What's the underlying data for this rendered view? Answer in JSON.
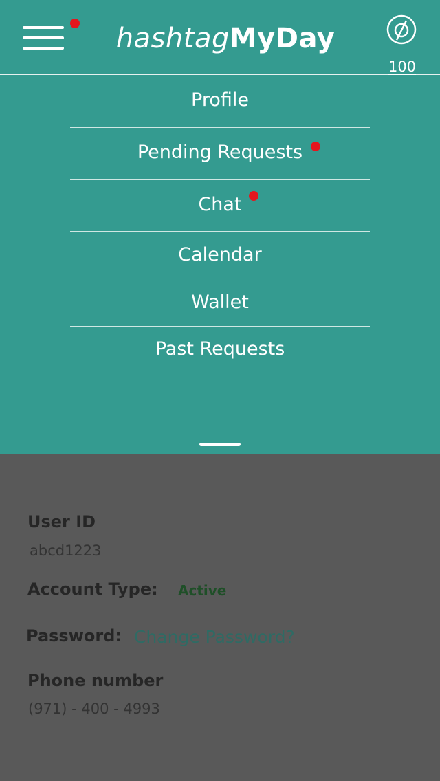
{
  "header": {
    "logo_light": "hashtag",
    "logo_bold": "MyDay",
    "coin_amount": "100",
    "menu_icon": "hamburger-menu-icon",
    "coin_icon": "coin-icon",
    "notification_color": "#e4161e"
  },
  "menu": {
    "items": [
      {
        "label": "Profile",
        "notification": false
      },
      {
        "label": "Pending Requests",
        "notification": true
      },
      {
        "label": "Chat",
        "notification": true
      },
      {
        "label": "Calendar",
        "notification": false
      },
      {
        "label": "Wallet",
        "notification": false
      },
      {
        "label": "Past Requests",
        "notification": false
      }
    ],
    "background_color": "#349b90"
  },
  "profile": {
    "user_id_label": "User ID",
    "user_id_value": "abcd1223",
    "account_type_label": "Account Type:",
    "account_type_value": "Active",
    "password_label": "Password:",
    "password_link": "Change Password?",
    "phone_label": "Phone number",
    "phone_value": "(971) - 400 - 4993"
  }
}
